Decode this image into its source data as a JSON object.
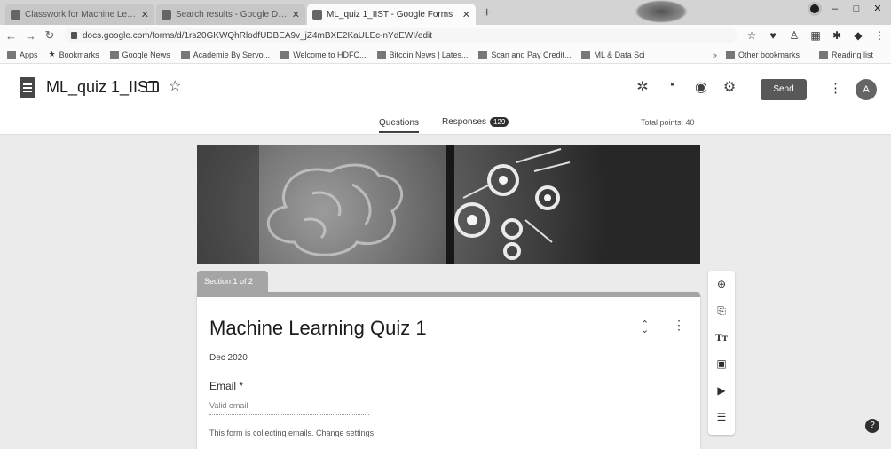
{
  "browser": {
    "tabs": [
      {
        "label": "Classwork for Machine Learning",
        "active": false
      },
      {
        "label": "Search results - Google Drive",
        "active": false
      },
      {
        "label": "ML_quiz 1_IIST - Google Forms",
        "active": true
      }
    ],
    "new_tab": "+",
    "url": "docs.google.com/forms/d/1rs20GKWQhRlodfUDBEA9v_jZ4mBXE2KaULEc-nYdEWI/edit",
    "bookmarks": [
      "Apps",
      "Bookmarks",
      "Google News",
      "Academie By Servo...",
      "Welcome to HDFC...",
      "Bitcoin News | Lates...",
      "Scan and Pay Credit...",
      "ML & Data Sci"
    ],
    "other_bookmarks": "Other bookmarks",
    "reading_list": "Reading list"
  },
  "header": {
    "title": "ML_quiz 1_IIST",
    "send_label": "Send",
    "avatar_letter": "A",
    "tabs": {
      "questions": "Questions",
      "responses": "Responses",
      "responses_count": "129"
    },
    "total_points": "Total points: 40"
  },
  "form": {
    "section_label": "Section 1 of 2",
    "title": "Machine Learning  Quiz 1",
    "description": "Dec 2020",
    "email_label": "Email *",
    "email_placeholder": "Valid email",
    "collect_note": "This form is collecting emails.  Change settings"
  },
  "icons": {
    "palette": "palette-icon",
    "preview": "eye-icon",
    "settings": "gear-icon",
    "addon": "puzzle-icon"
  }
}
